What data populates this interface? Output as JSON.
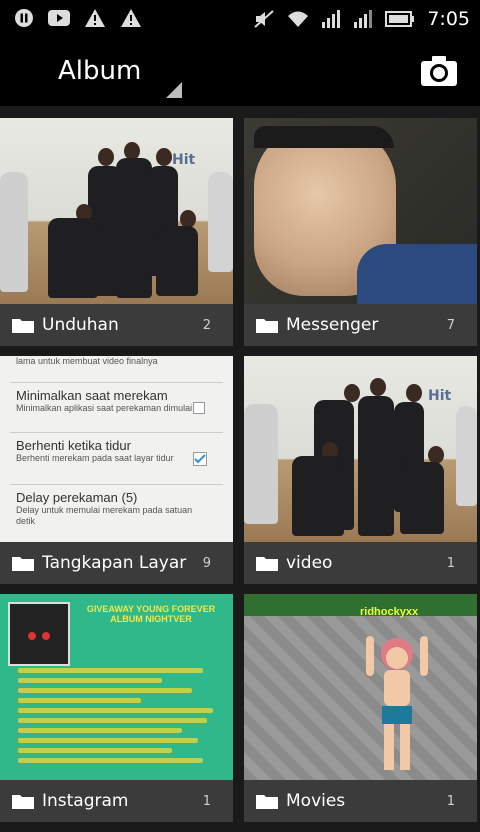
{
  "status_bar": {
    "time": "7:05",
    "left_icons": [
      "pause-icon",
      "youtube-icon",
      "warning-icon",
      "warning-icon"
    ],
    "right_icons": [
      "mute-icon",
      "wifi-icon",
      "signal-icon",
      "signal-icon",
      "battery-icon"
    ]
  },
  "action_bar": {
    "title": "Album",
    "camera_icon": "camera-icon"
  },
  "albums": [
    {
      "name": "Unduhan",
      "count": "2"
    },
    {
      "name": "Messenger",
      "count": "7"
    },
    {
      "name": "Tangkapan Layar",
      "count": "9"
    },
    {
      "name": "video",
      "count": "1"
    },
    {
      "name": "Instagram",
      "count": "1"
    },
    {
      "name": "Movies",
      "count": "1"
    }
  ],
  "screenshot_thumb": {
    "item1_sub": "lama untuk membuat video finalnya",
    "item2_title": "Minimalkan saat merekam",
    "item2_sub": "Minimalkan aplikasi saat perekaman dimulai",
    "item3_title": "Berhenti ketika tidur",
    "item3_sub": "Berhenti merekam pada saat layar tidur",
    "item4_title": "Delay perekaman (5)",
    "item4_sub": "Delay untuk memulai merekam pada satuan detik"
  },
  "giveaway_thumb": {
    "title": "GIVEAWAY YOUNG FOREVER ALBUM NIGHTVER"
  },
  "game_thumb": {
    "player_name": "ridhockyxx"
  },
  "dance_thumb": {
    "sign": "Hit"
  },
  "colors": {
    "label_bar": "#3a3a3a",
    "check_accent": "#2f8fd8"
  }
}
